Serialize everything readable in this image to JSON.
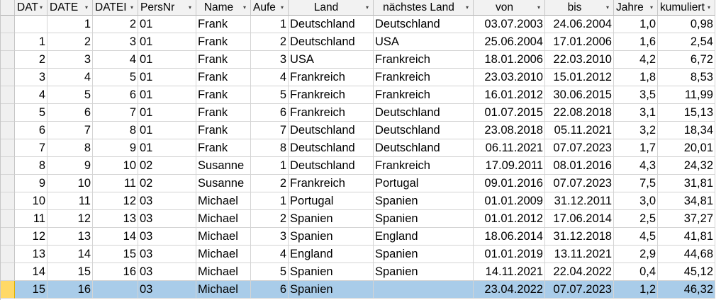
{
  "columns": [
    {
      "label": "DAT",
      "align": "num"
    },
    {
      "label": "DATE",
      "align": "num"
    },
    {
      "label": "DATEI",
      "align": "num"
    },
    {
      "label": "PersNr",
      "align": "txt"
    },
    {
      "label": "Name",
      "align": "txt",
      "center": true
    },
    {
      "label": "Aufe",
      "align": "num"
    },
    {
      "label": "Land",
      "align": "txt",
      "center": true
    },
    {
      "label": "nächstes Land",
      "align": "txt",
      "center": true
    },
    {
      "label": "von",
      "align": "num",
      "center": true
    },
    {
      "label": "bis",
      "align": "num",
      "center": true
    },
    {
      "label": "Jahre",
      "align": "num"
    },
    {
      "label": "kumuliert",
      "align": "num"
    }
  ],
  "rows": [
    [
      "",
      "1",
      "2",
      "01",
      "Frank",
      "1",
      "Deutschland",
      "Deutschland",
      "03.07.2003",
      "24.06.2004",
      "1,0",
      "0,98"
    ],
    [
      "1",
      "2",
      "3",
      "01",
      "Frank",
      "2",
      "Deutschland",
      "USA",
      "25.06.2004",
      "17.01.2006",
      "1,6",
      "2,54"
    ],
    [
      "2",
      "3",
      "4",
      "01",
      "Frank",
      "3",
      "USA",
      "Frankreich",
      "18.01.2006",
      "22.03.2010",
      "4,2",
      "6,72"
    ],
    [
      "3",
      "4",
      "5",
      "01",
      "Frank",
      "4",
      "Frankreich",
      "Frankreich",
      "23.03.2010",
      "15.01.2012",
      "1,8",
      "8,53"
    ],
    [
      "4",
      "5",
      "6",
      "01",
      "Frank",
      "5",
      "Frankreich",
      "Frankreich",
      "16.01.2012",
      "30.06.2015",
      "3,5",
      "11,99"
    ],
    [
      "5",
      "6",
      "7",
      "01",
      "Frank",
      "6",
      "Frankreich",
      "Deutschland",
      "01.07.2015",
      "22.08.2018",
      "3,1",
      "15,13"
    ],
    [
      "6",
      "7",
      "8",
      "01",
      "Frank",
      "7",
      "Deutschland",
      "Deutschland",
      "23.08.2018",
      "05.11.2021",
      "3,2",
      "18,34"
    ],
    [
      "7",
      "8",
      "9",
      "01",
      "Frank",
      "8",
      "Deutschland",
      "Deutschland",
      "06.11.2021",
      "07.07.2023",
      "1,7",
      "20,01"
    ],
    [
      "8",
      "9",
      "10",
      "02",
      "Susanne",
      "1",
      "Deutschland",
      "Frankreich",
      "17.09.2011",
      "08.01.2016",
      "4,3",
      "24,32"
    ],
    [
      "9",
      "10",
      "11",
      "02",
      "Susanne",
      "2",
      "Frankreich",
      "Portugal",
      "09.01.2016",
      "07.07.2023",
      "7,5",
      "31,81"
    ],
    [
      "10",
      "11",
      "12",
      "03",
      "Michael",
      "1",
      "Portugal",
      "Spanien",
      "01.01.2009",
      "31.12.2011",
      "3,0",
      "34,81"
    ],
    [
      "11",
      "12",
      "13",
      "03",
      "Michael",
      "2",
      "Spanien",
      "Spanien",
      "01.01.2012",
      "17.06.2014",
      "2,5",
      "37,27"
    ],
    [
      "12",
      "13",
      "14",
      "03",
      "Michael",
      "3",
      "Spanien",
      "England",
      "18.06.2014",
      "31.12.2018",
      "4,5",
      "41,81"
    ],
    [
      "13",
      "14",
      "15",
      "03",
      "Michael",
      "4",
      "England",
      "Spanien",
      "01.01.2019",
      "13.11.2021",
      "2,9",
      "44,68"
    ],
    [
      "14",
      "15",
      "16",
      "03",
      "Michael",
      "5",
      "Spanien",
      "Spanien",
      "14.11.2021",
      "22.04.2022",
      "0,4",
      "45,12"
    ],
    [
      "15",
      "16",
      "",
      "03",
      "Michael",
      "6",
      "Spanien",
      "",
      "23.04.2022",
      "07.07.2023",
      "1,2",
      "46,32"
    ]
  ],
  "selected_row": 15,
  "colors": {
    "header_bg": "#f2f2f2",
    "selected_row_bg": "#a9cce9",
    "active_selector": "#ffd966",
    "gridline": "#d4d4d4"
  },
  "icons": {
    "filter_arrow": "dropdown-arrow-icon"
  }
}
